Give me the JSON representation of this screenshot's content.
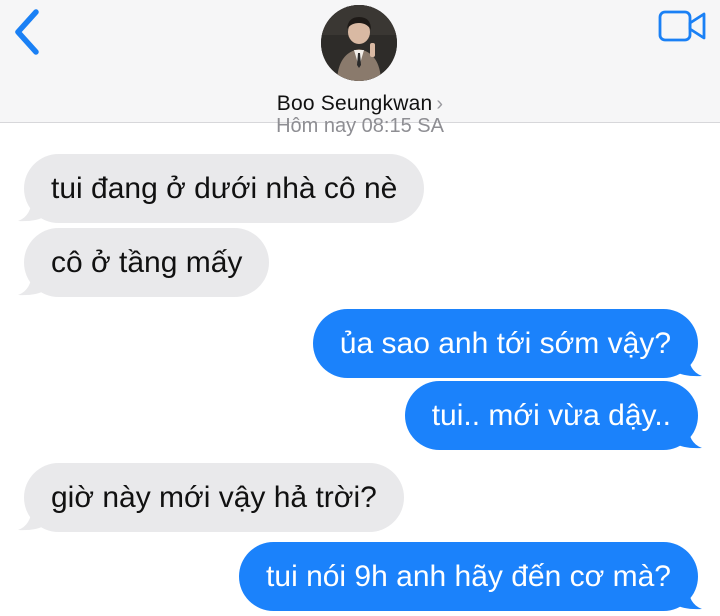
{
  "header": {
    "contact_name": "Boo Seungkwan",
    "back_icon": "chevron-left-icon",
    "video_icon": "video-camera-icon",
    "chevron": "›"
  },
  "timestamp": "Hôm nay 08:15 SA",
  "messages": [
    {
      "direction": "received",
      "text": "tui đang ở dưới nhà cô nè"
    },
    {
      "direction": "received",
      "text": "cô ở tầng mấy"
    },
    {
      "direction": "sent",
      "text": "ủa sao anh tới sớm vậy?"
    },
    {
      "direction": "sent",
      "text": "tui.. mới vừa dậy.."
    },
    {
      "direction": "received",
      "text": "giờ này mới vậy hả trời?"
    },
    {
      "direction": "sent",
      "text": "tui nói 9h anh hãy đến cơ mà?"
    }
  ],
  "colors": {
    "sent_bubble": "#1b82fb",
    "received_bubble": "#e9e9eb",
    "accent": "#1a80f5",
    "header_bg": "#f6f6f7"
  }
}
